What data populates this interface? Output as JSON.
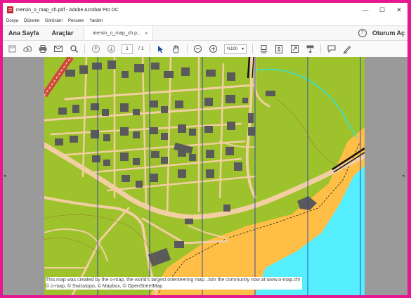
{
  "window": {
    "title": "mersin_o_map_ch.pdf - Adobe Acrobat Pro DC",
    "minimize": "—",
    "maximize": "☐",
    "close": "✕"
  },
  "menu": [
    "Dosya",
    "Düzenle",
    "Görünüm",
    "Pencere",
    "Yardım"
  ],
  "tabs": {
    "home": "Ana Sayfa",
    "tools": "Araçlar",
    "document": "mersin_o_map_ch.p...",
    "close": "×",
    "help": "?",
    "signin": "Oturum Aç"
  },
  "toolbar": {
    "page_current": "1",
    "page_total": "/ 1",
    "zoom": "%100"
  },
  "map": {
    "attribution_line1": "This map was created by the o-map, the world's largest orienteering map. Join the community now at www.o-map.ch!",
    "attribution_line2": "© o-map, © Swisstopo, © Mapbox, © OpenStreetMap",
    "colors": {
      "vegetation": "#9dc22c",
      "building": "#5a5a5a",
      "road": "#f2cfa3",
      "sand": "#ffbf47",
      "water": "#55eefe",
      "magnetic_lines": "#2b3bb0",
      "railway": "#d04a3a"
    }
  }
}
